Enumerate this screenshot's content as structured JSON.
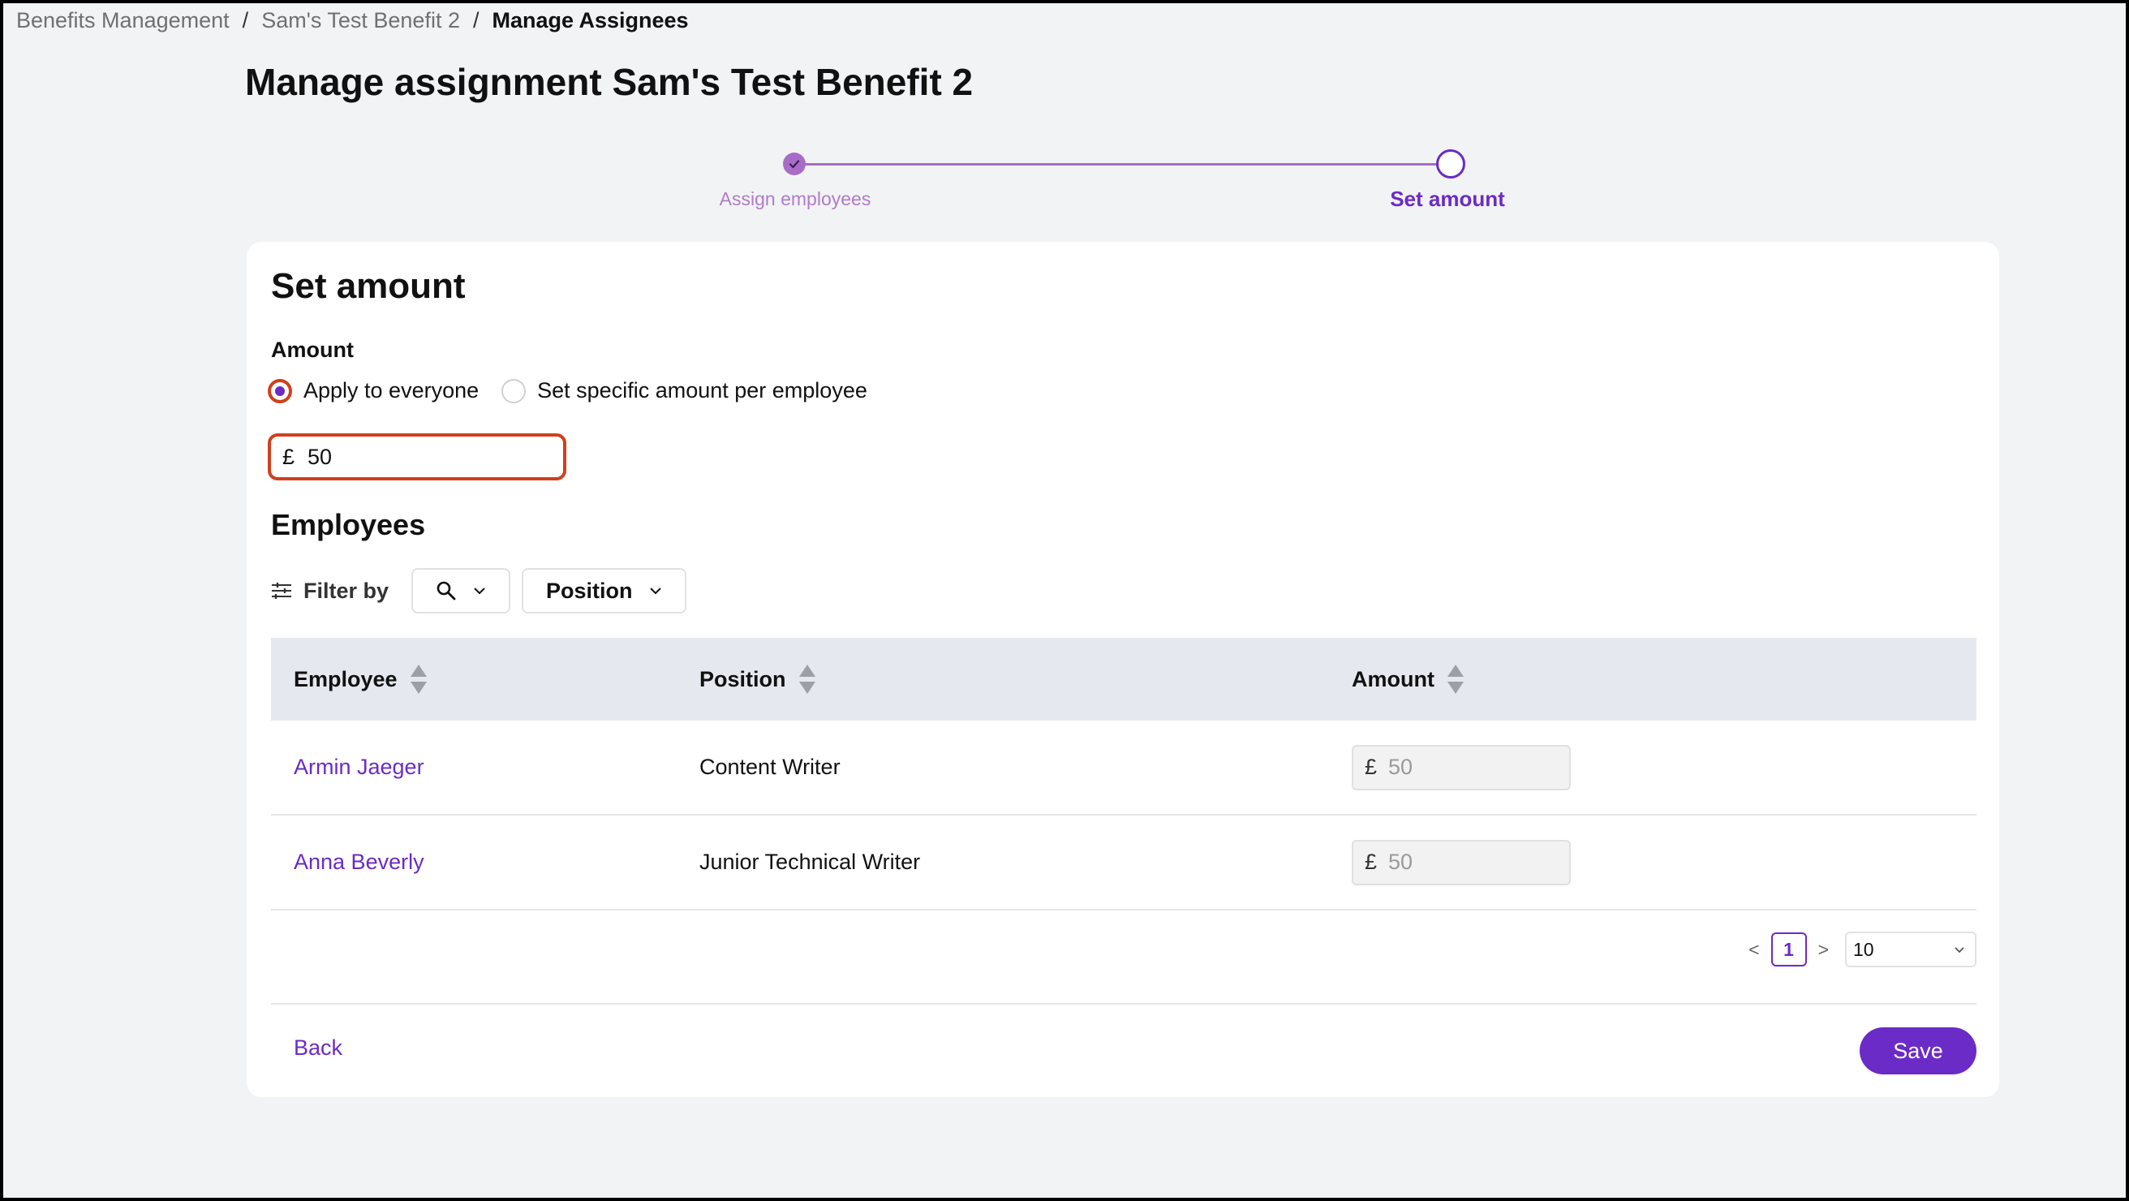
{
  "breadcrumb": {
    "items": [
      "Benefits Management",
      "Sam's Test Benefit 2"
    ],
    "current": "Manage Assignees",
    "separator": "/"
  },
  "page_title": "Manage assignment Sam's Test Benefit 2",
  "stepper": {
    "steps": [
      {
        "label": "Assign employees",
        "state": "completed"
      },
      {
        "label": "Set amount",
        "state": "current"
      }
    ]
  },
  "card": {
    "title": "Set amount",
    "amount_label": "Amount",
    "radio_options": [
      {
        "label": "Apply to everyone",
        "checked": true
      },
      {
        "label": "Set specific amount per employee",
        "checked": false
      }
    ],
    "amount_input": {
      "currency": "£",
      "value": "50"
    },
    "employees_title": "Employees",
    "filter": {
      "label": "Filter by",
      "search_icon": "search-icon",
      "position_label": "Position"
    },
    "table": {
      "columns": [
        "Employee",
        "Position",
        "Amount"
      ],
      "rows": [
        {
          "employee": "Armin Jaeger",
          "position": "Content Writer",
          "currency": "£",
          "amount": "50"
        },
        {
          "employee": "Anna Beverly",
          "position": "Junior Technical Writer",
          "currency": "£",
          "amount": "50"
        }
      ]
    },
    "pagination": {
      "prev": "<",
      "next": ">",
      "current_page": "1",
      "page_size": "10"
    },
    "back_label": "Back",
    "save_label": "Save"
  },
  "colors": {
    "accent": "#6b2bc7",
    "accent_light": "#a96cc6",
    "focus_ring": "#d1401c",
    "table_header_bg": "#e5e9ef",
    "page_bg": "#f2f3f5"
  }
}
